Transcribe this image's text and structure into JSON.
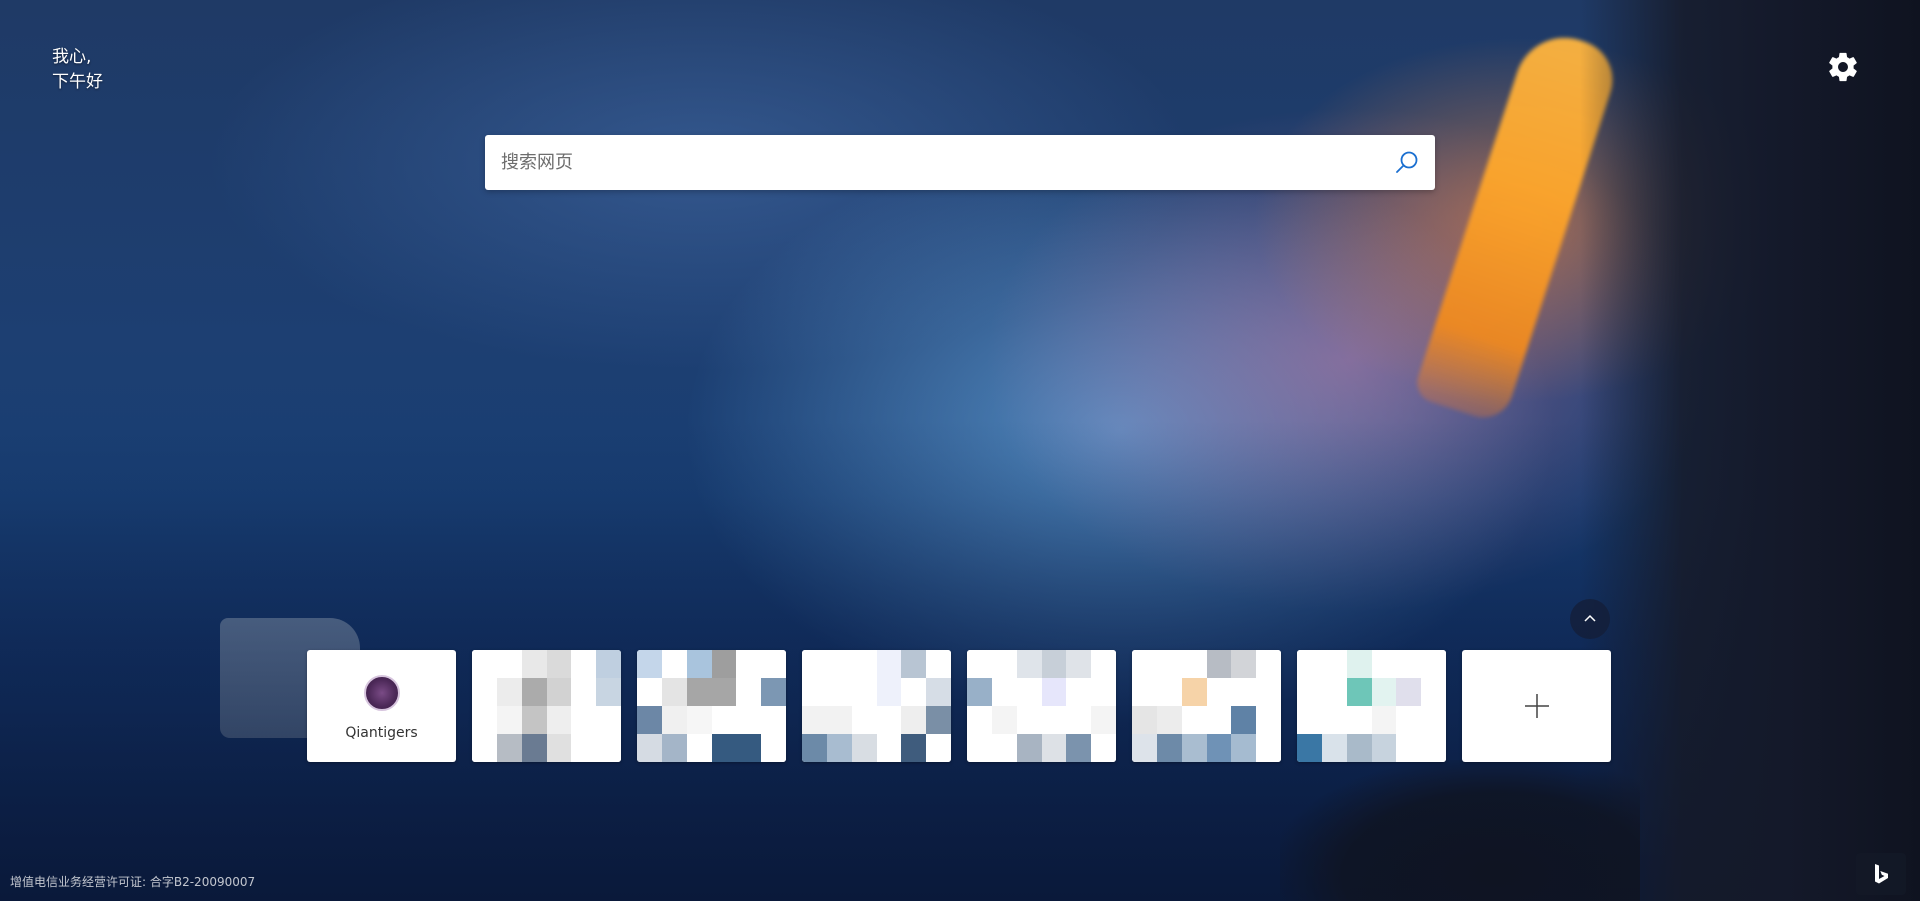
{
  "greeting": {
    "line1": "我心,",
    "line2": "下午好"
  },
  "search": {
    "placeholder": "搜索网页",
    "value": ""
  },
  "tiles": [
    {
      "label": "Qiantigers"
    }
  ],
  "footer": {
    "license": "增值电信业务经营许可证: 合字B2-20090007"
  },
  "icons": {
    "settings": "gear-icon",
    "search": "search-icon",
    "collapse": "chevron-up-icon",
    "add": "plus-icon",
    "bing": "bing-logo-icon"
  },
  "colors": {
    "search_icon": "#1a6fd0",
    "tile_background": "#ffffff"
  }
}
